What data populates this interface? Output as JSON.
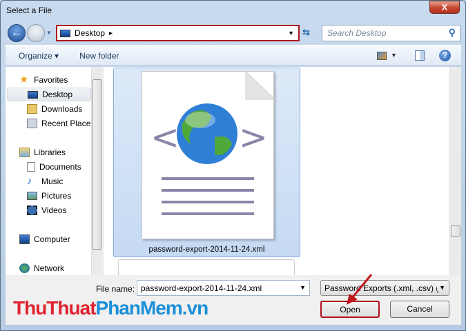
{
  "window": {
    "title": "Select a File",
    "close": "X"
  },
  "address": {
    "location": "Desktop",
    "separator": "▸",
    "search_placeholder": "Search Desktop"
  },
  "toolbar": {
    "organize": "Organize ▾",
    "new_folder": "New folder",
    "help": "?"
  },
  "sidebar": {
    "items": [
      "Favorites",
      "Desktop",
      "Downloads",
      "Recent Places",
      "Libraries",
      "Documents",
      "Music",
      "Pictures",
      "Videos",
      "Computer",
      "Network"
    ]
  },
  "files": [
    {
      "name": "password-export-2014-11-24.xml"
    }
  ],
  "footer": {
    "file_name_label": "File name:",
    "file_name_value": "password-export-2014-11-24.xml",
    "file_type": "Password Exports (.xml, .csv) (*.",
    "open": "Open",
    "cancel": "Cancel"
  },
  "watermark": {
    "part1": "ThuThuat",
    "part2": "PhanMem.vn"
  }
}
